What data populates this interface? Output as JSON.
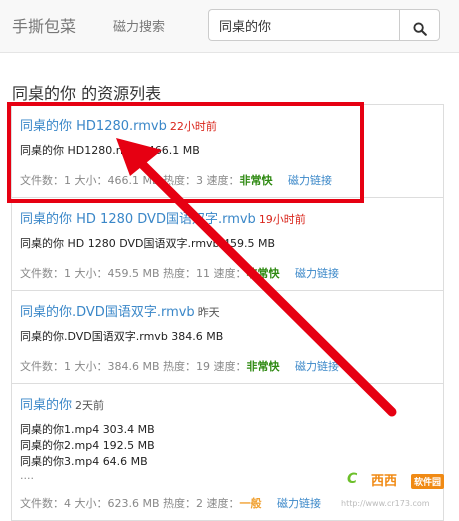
{
  "header": {
    "brand": "手撕包菜",
    "nav_link": "磁力搜索",
    "search_value": "同桌的你",
    "search_icon": "search-icon"
  },
  "list_title": "同桌的你 的资源列表",
  "labels": {
    "file_count": "文件数：",
    "size": "大小：",
    "hotness": "热度：",
    "speed": "速度：",
    "magnet": "磁力链接"
  },
  "results": [
    {
      "title": "同桌的你 HD1280.rmvb",
      "time": "22小时前",
      "time_color": "#d9251b",
      "files": [
        "同桌的你 HD1280.rmvb 466.1 MB"
      ],
      "has_more": false,
      "file_count": "1",
      "size": "466.1 MB",
      "hotness": "3",
      "speed": "非常快",
      "speed_color": "#2f8a12"
    },
    {
      "title": "同桌的你 HD 1280 DVD国语双字.rmvb",
      "time": "19小时前",
      "time_color": "#d9251b",
      "files": [
        "同桌的你 HD 1280 DVD国语双字.rmvb 459.5 MB"
      ],
      "has_more": false,
      "file_count": "1",
      "size": "459.5 MB",
      "hotness": "11",
      "speed": "非常快",
      "speed_color": "#2f8a12"
    },
    {
      "title": "同桌的你.DVD国语双字.rmvb",
      "time": "昨天",
      "time_color": "#555555",
      "files": [
        "同桌的你.DVD国语双字.rmvb 384.6 MB"
      ],
      "has_more": false,
      "file_count": "1",
      "size": "384.6 MB",
      "hotness": "19",
      "speed": "非常快",
      "speed_color": "#2f8a12"
    },
    {
      "title": "同桌的你",
      "time": "2天前",
      "time_color": "#555555",
      "files": [
        "同桌的你1.mp4 303.4 MB",
        "同桌的你2.mp4 192.5 MB",
        "同桌的你3.mp4 64.6 MB"
      ],
      "has_more": true,
      "more_text": "....",
      "file_count": "4",
      "size": "623.6 MB",
      "hotness": "2",
      "speed": "一般",
      "speed_color": "#f0a030"
    }
  ],
  "watermark": {
    "logo": "C",
    "site": "西西",
    "tag": "软件园",
    "url": "http://www.cr173.com"
  },
  "overlay": {
    "highlight_color": "#e60012"
  }
}
